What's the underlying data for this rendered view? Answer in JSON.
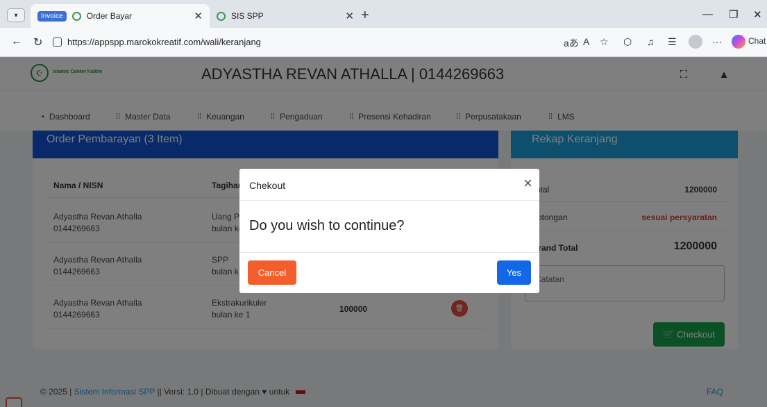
{
  "browser": {
    "tab_group": "Invoice",
    "tabs": [
      {
        "title": "Order Bayar"
      },
      {
        "title": "SIS SPP"
      }
    ],
    "url": "https://appspp.marokokreatif.com/wali/keranjang",
    "chat_label": "Chat"
  },
  "header": {
    "logo_text": "Islamic Center Kaltim",
    "title": "ADYASTHA REVAN ATHALLA | 0144269663"
  },
  "menu": [
    {
      "label": "Dashboard"
    },
    {
      "label": "Master Data"
    },
    {
      "label": "Keuangan"
    },
    {
      "label": "Pengaduan"
    },
    {
      "label": "Presensi Kehadiran"
    },
    {
      "label": "Perpusatakaan"
    },
    {
      "label": "LMS"
    }
  ],
  "order": {
    "title": "Order Pembarayan (3 Item)",
    "col_name": "Nama / NISN",
    "col_tagihan": "Tagihan",
    "rows": [
      {
        "name": "Adyastha Revan Athalla",
        "nisn": "0144269663",
        "tagihan": "Uang P",
        "detail": "bulan ke",
        "amount": ""
      },
      {
        "name": "Adyastha Revan Athalla",
        "nisn": "0144269663",
        "tagihan": "SPP",
        "detail": "bulan k",
        "amount": ""
      },
      {
        "name": "Adyastha Revan Athalla",
        "nisn": "0144269663",
        "tagihan": "Ekstrakurikuler",
        "detail": "bulan ke 1",
        "amount": "100000"
      }
    ]
  },
  "rekap": {
    "title": "Rekap Keranjang",
    "total_label": "Total",
    "total_value": "1200000",
    "potongan_label": "Potongan",
    "potongan_value": "sesuai persyaratan",
    "grand_label": "Grand Total",
    "grand_value": "1200000",
    "notes_placeholder": "Catatan",
    "checkout_label": "Checkout"
  },
  "footer": {
    "prefix": "© 2025 |",
    "link": "Sistem Informasi SPP",
    "suffix": "|| Versi: 1.0 | Dibuat dengan",
    "suffix2": "untuk",
    "faq": "FAQ"
  },
  "modal": {
    "title": "Chekout",
    "body": "Do you wish to continue?",
    "cancel": "Cancel",
    "yes": "Yes"
  },
  "colors": {
    "order_header": "#1054d6",
    "rekap_header": "#1a9fd8",
    "cancel": "#f45d2c",
    "yes": "#1268e6",
    "checkout": "#18a34a",
    "potongan": "#d9412b"
  }
}
